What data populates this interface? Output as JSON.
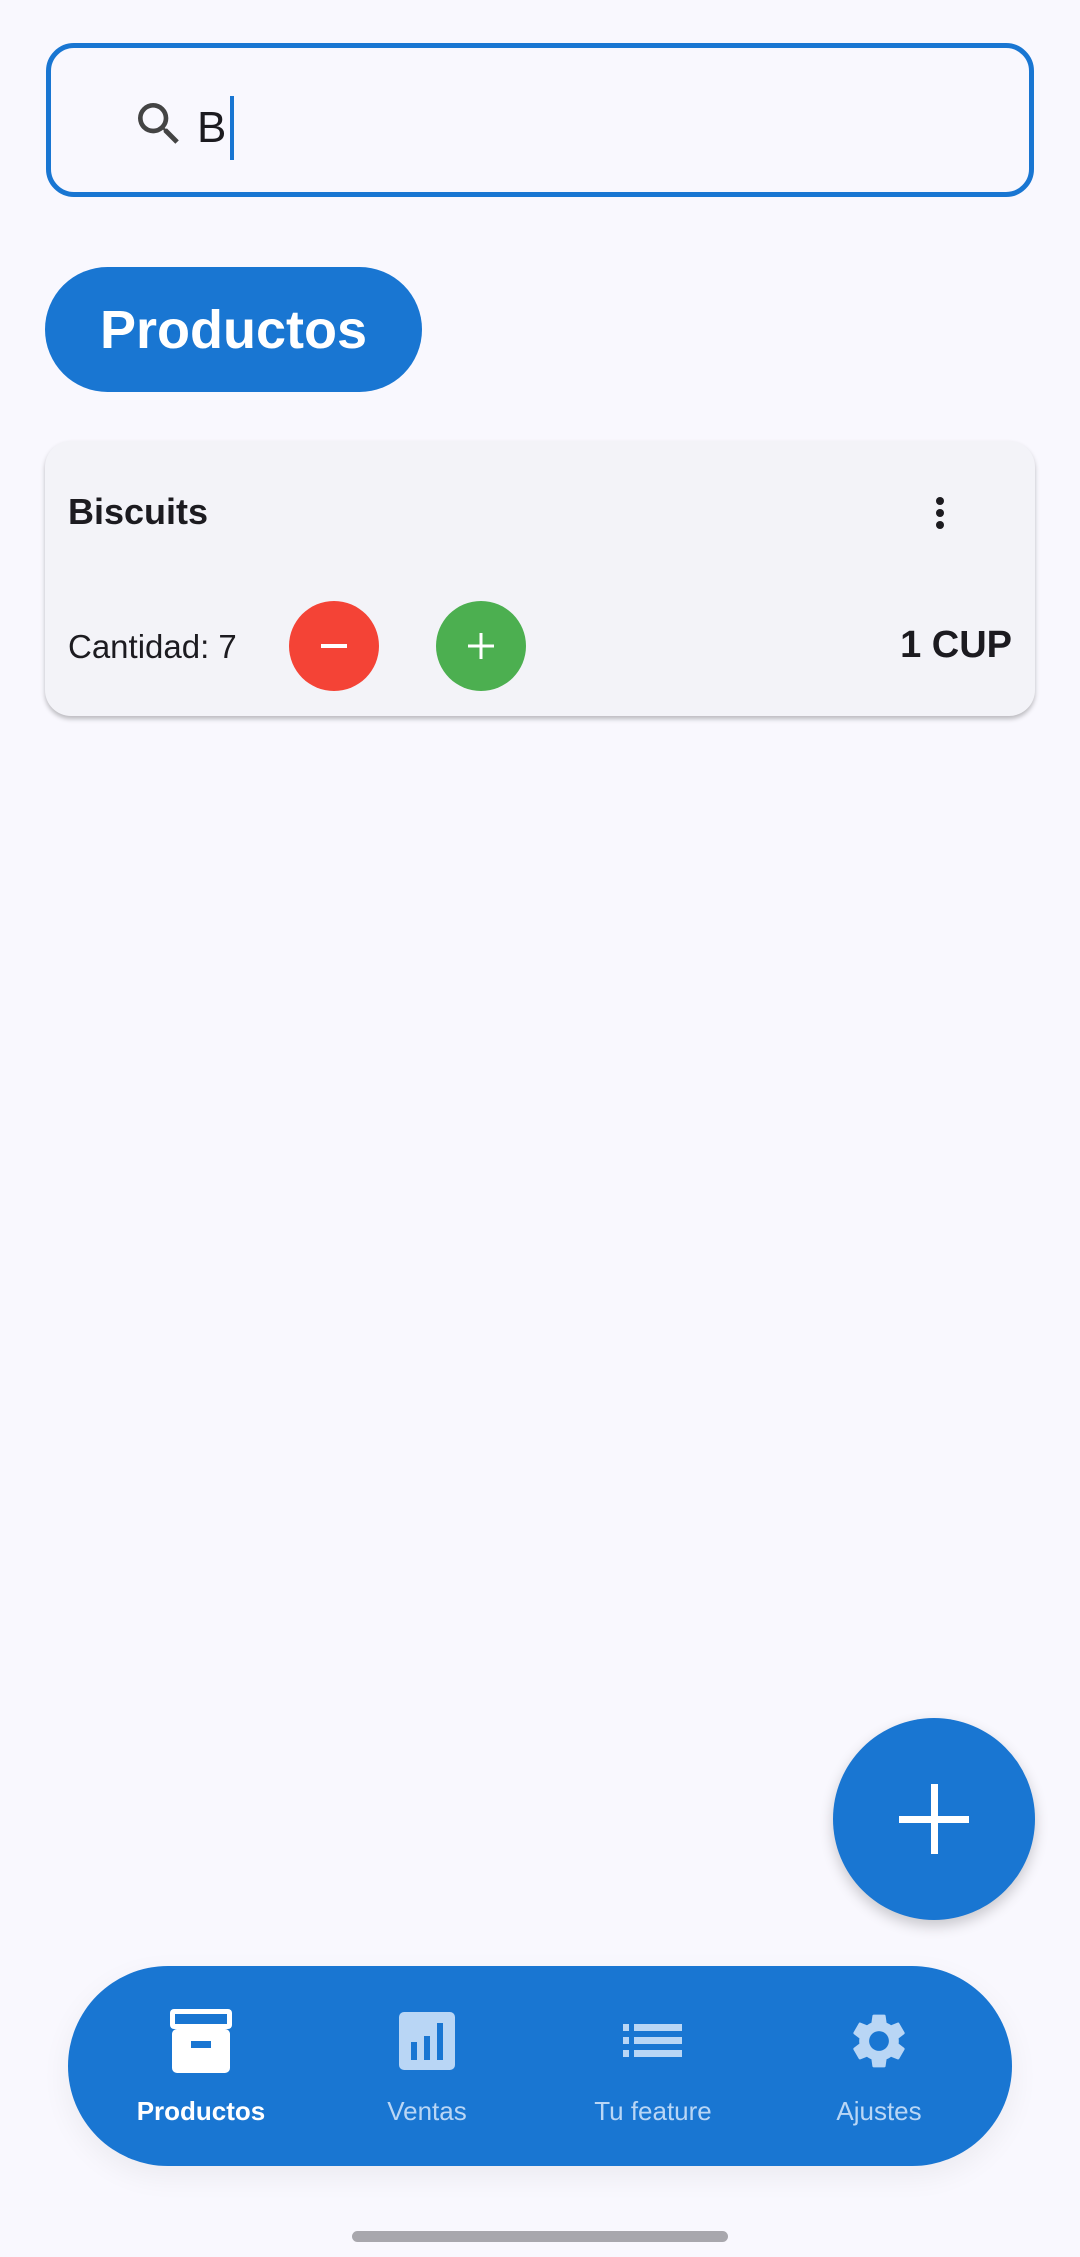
{
  "search": {
    "value": "B",
    "icon": "search-icon"
  },
  "filter_chip": {
    "label": "Productos"
  },
  "products": [
    {
      "name": "Biscuits",
      "quantity_label": "Cantidad: 7",
      "price": "1 CUP"
    }
  ],
  "fab": {
    "icon": "plus-icon"
  },
  "bottom_nav": {
    "items": [
      {
        "label": "Productos",
        "icon": "archive-icon",
        "active": true
      },
      {
        "label": "Ventas",
        "icon": "bar-chart-icon",
        "active": false
      },
      {
        "label": "Tu feature",
        "icon": "list-icon",
        "active": false
      },
      {
        "label": "Ajustes",
        "icon": "gear-icon",
        "active": false
      }
    ]
  },
  "colors": {
    "primary": "#1976d2",
    "decrement": "#f44336",
    "increment": "#4caf50"
  }
}
